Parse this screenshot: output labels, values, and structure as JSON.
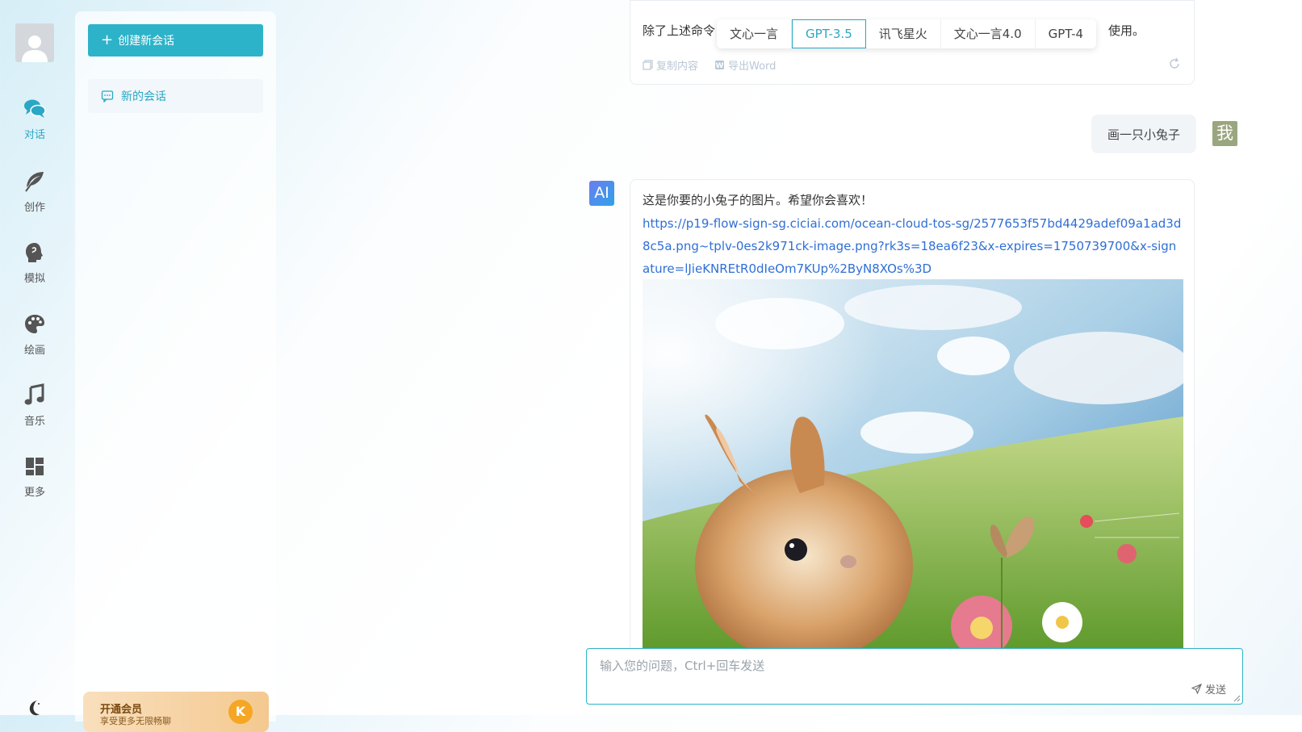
{
  "nav": {
    "items": [
      {
        "label": "对话",
        "icon": "chat-bubbles-icon",
        "active": true
      },
      {
        "label": "创作",
        "icon": "feather-icon"
      },
      {
        "label": "模拟",
        "icon": "head-profile-icon"
      },
      {
        "label": "绘画",
        "icon": "palette-icon"
      },
      {
        "label": "音乐",
        "icon": "music-note-icon"
      },
      {
        "label": "更多",
        "icon": "grid-icon"
      }
    ],
    "theme_icon": "moon-icon"
  },
  "panel": {
    "new_chat_label": "创建新会话",
    "conversations": [
      {
        "title": "新的会话"
      }
    ],
    "vip": {
      "title": "开通会员",
      "sub": "享受更多无限畅聊",
      "badge": "K"
    }
  },
  "messages": {
    "previous": {
      "text_start": "除了上述命令",
      "text_end": "使用。",
      "copy_label": "复制内容",
      "export_label": "导出Word"
    },
    "user": {
      "text": "画一只小兔子",
      "avatar": "我"
    },
    "ai": {
      "avatar": "AI",
      "text": "这是你要的小兔子的图片。希望你会喜欢！",
      "link": "https://p19-flow-sign-sg.ciciai.com/ocean-cloud-tos-sg/2577653f57bd4429adef09a1ad3d8c5a.png~tplv-0es2k971ck-image.png?rk3s=18ea6f23&x-expires=1750739700&x-signature=lJieKNREtR0dIeOm7KUp%2ByN8XOs%3D"
    }
  },
  "models": {
    "options": [
      "文心一言",
      "GPT-3.5",
      "讯飞星火",
      "文心一言4.0",
      "GPT-4"
    ],
    "selected": "GPT-3.5"
  },
  "input": {
    "placeholder": "输入您的问题，Ctrl+回车发送",
    "send_label": "发送"
  },
  "colors": {
    "accent": "#2db3c9",
    "link": "#2f6fd6"
  }
}
